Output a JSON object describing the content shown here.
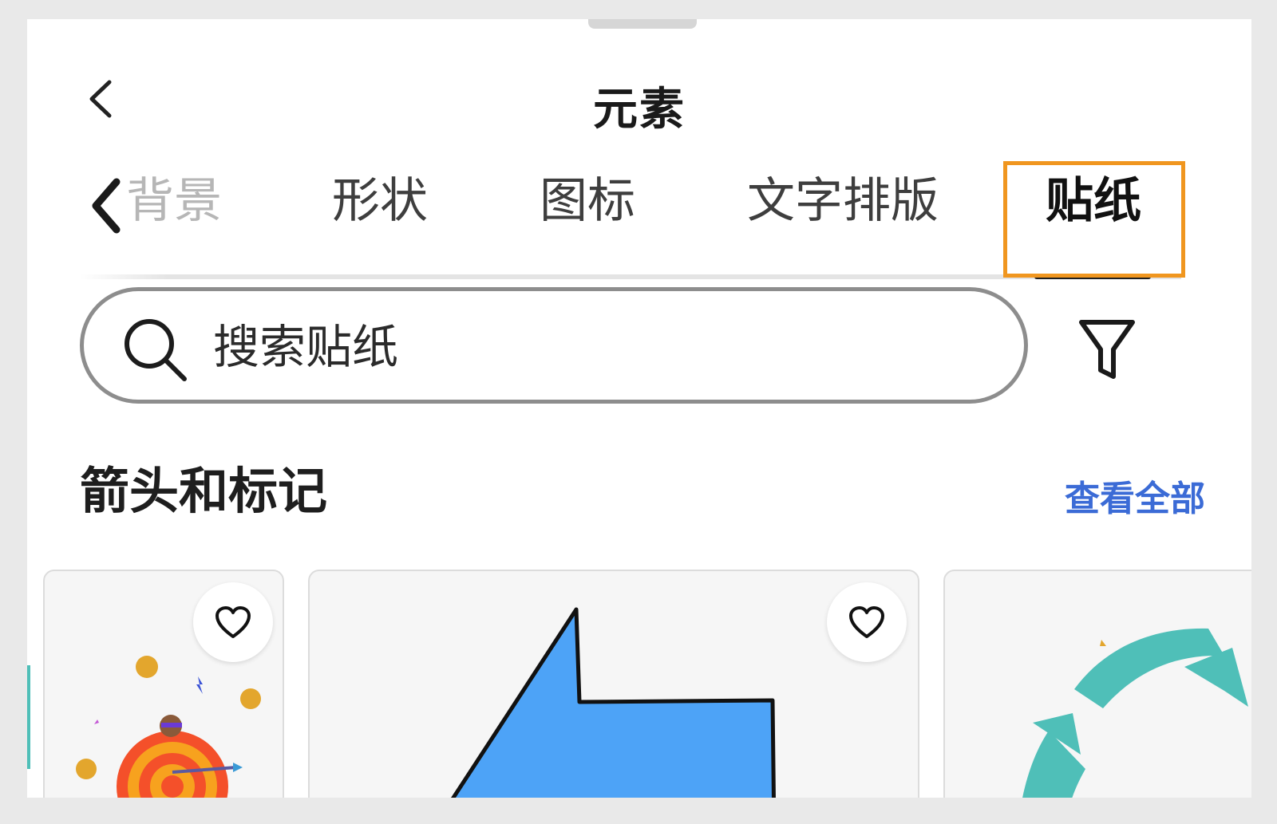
{
  "header": {
    "title": "元素",
    "back_icon": "chevron-left-icon"
  },
  "tabs": {
    "scroll_icon": "chevron-left-icon",
    "items": [
      {
        "label": "背景"
      },
      {
        "label": "形状"
      },
      {
        "label": "图标"
      },
      {
        "label": "文字排版"
      },
      {
        "label": "贴纸"
      }
    ],
    "active_index": 4,
    "highlight_color": "#f0961f"
  },
  "search": {
    "placeholder": "搜索贴纸",
    "icon": "search-icon",
    "filter_icon": "filter-icon"
  },
  "section": {
    "title": "箭头和标记",
    "view_all_label": "查看全部",
    "link_color": "#3b6bd6"
  },
  "cards": [
    {
      "name": "target-arrow-sticker",
      "favorite_icon": "heart-icon"
    },
    {
      "name": "blue-arrow-sticker",
      "favorite_icon": "heart-icon"
    },
    {
      "name": "teal-circular-arrows-sticker"
    }
  ]
}
